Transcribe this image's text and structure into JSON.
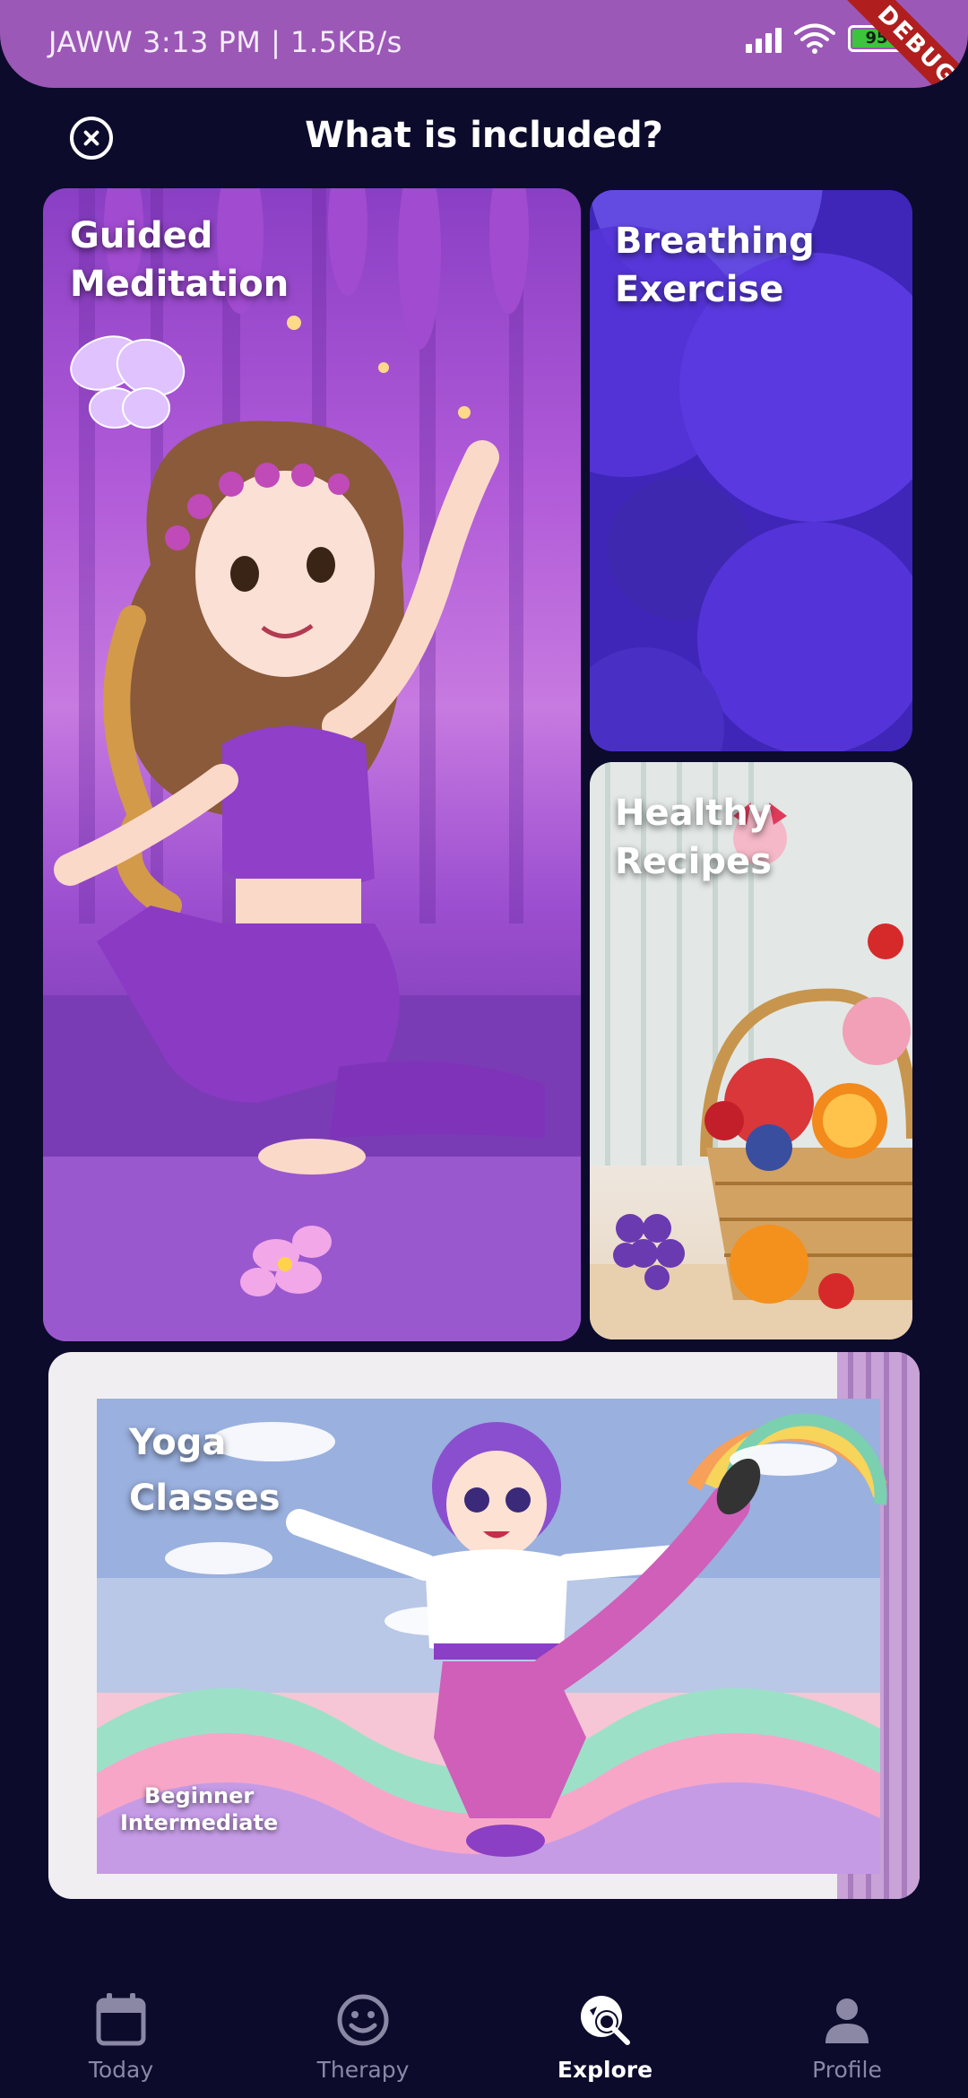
{
  "status_bar": {
    "left_text": "JAWW 3:13 PM | 1.5KB/s",
    "battery": "95",
    "debug_banner": "DEBUG"
  },
  "header": {
    "title": "What is included?"
  },
  "cards": {
    "meditation": {
      "title": "Guided\nMeditation"
    },
    "breathing": {
      "title": "Breathing\nExercise"
    },
    "recipes": {
      "title": "Healthy\nRecipes"
    },
    "yoga": {
      "title": "Yoga\nClasses",
      "levels": "Beginner\nIntermediate"
    }
  },
  "bottom_nav": {
    "items": [
      {
        "label": "Today",
        "icon": "calendar-icon"
      },
      {
        "label": "Therapy",
        "icon": "smiley-icon"
      },
      {
        "label": "Explore",
        "icon": "explore-search-icon",
        "active": true
      },
      {
        "label": "Profile",
        "icon": "person-icon"
      }
    ]
  },
  "colors": {
    "background": "#0c0b2c",
    "status_bar": "#9b58b6",
    "nav_active": "#ffffff",
    "nav_inactive": "#8a88a4"
  }
}
